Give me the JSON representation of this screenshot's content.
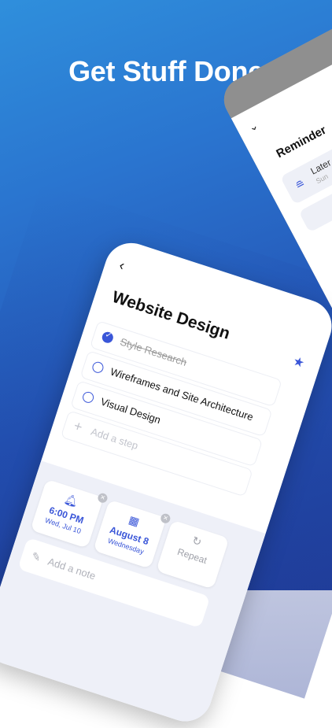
{
  "headline": "Get Stuff Done",
  "reminder_screen": {
    "title": "Reminder",
    "option": {
      "label": "Later",
      "sub": "Sun"
    }
  },
  "task_screen": {
    "title": "Website Design",
    "steps": [
      {
        "label": "Style Research",
        "done": true
      },
      {
        "label": "Wireframes and Site Architecture",
        "done": false
      },
      {
        "label": "Visual Design",
        "done": false
      }
    ],
    "add_step_placeholder": "Add a step",
    "reminder_tile": {
      "time": "6:00 PM",
      "date": "Wed, Jul 10"
    },
    "due_tile": {
      "date": "August 8",
      "day": "Wednesday"
    },
    "repeat_tile": {
      "label": "Repeat"
    },
    "note_placeholder": "Add a note"
  },
  "colors": {
    "accent": "#3a56d8",
    "bg_top": "#2f8fdc",
    "bg_bottom": "#23439f"
  },
  "icons": [
    "back-arrow-icon",
    "star-icon",
    "bell-icon",
    "calendar-icon",
    "repeat-icon",
    "pencil-icon",
    "plus-icon",
    "close-icon"
  ]
}
